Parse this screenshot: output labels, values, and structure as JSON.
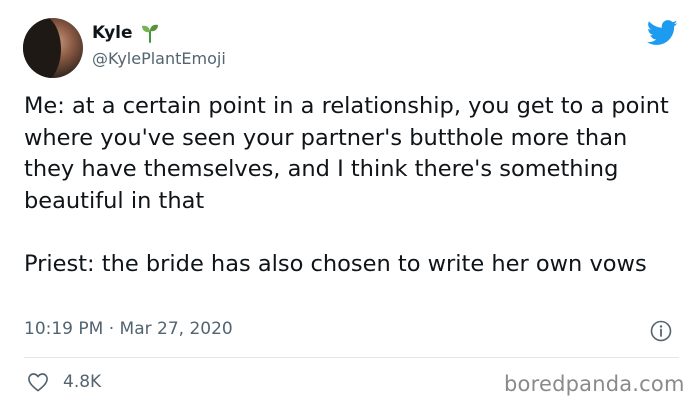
{
  "author": {
    "name": "Kyle",
    "handle": "@KylePlantEmoji",
    "emoji_icon": "sprout-icon"
  },
  "tweet": {
    "paragraphs": [
      "Me: at a certain point in a relationship, you get to a point where you've seen your partner's butthole more than they have themselves, and I think there's something beautiful in that",
      "Priest: the bride has also chosen to write her own vows"
    ],
    "time": "10:19 PM",
    "separator": "·",
    "date": "Mar 27, 2020",
    "likes": "4.8K"
  },
  "brand": {
    "platform_icon": "twitter-bird-icon",
    "accent_color": "#1d9bf0"
  },
  "watermark": "boredpanda.com"
}
